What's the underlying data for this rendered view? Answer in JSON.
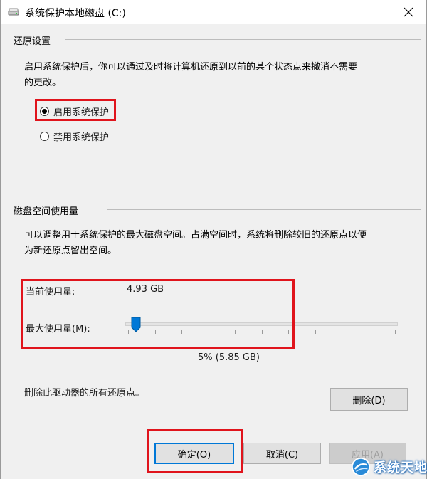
{
  "window": {
    "title": "系统保护本地磁盘 (C:)",
    "close_glyph": "✕"
  },
  "restore_settings": {
    "group_label": "还原设置",
    "description_line1": "启用系统保护后，你可以通过及时将计算机还原到以前的某个状态点来撤消不需要",
    "description_line2": "的更改。",
    "options": [
      {
        "label": "启用系统保护",
        "selected": true
      },
      {
        "label": "禁用系统保护",
        "selected": false
      }
    ]
  },
  "disk_usage": {
    "group_label": "磁盘空间使用量",
    "description_line1": "可以调整用于系统保护的最大磁盘空间。占满空间时，系统将删除较旧的还原点以便",
    "description_line2": "为新还原点留出空间。",
    "current_usage_label": "当前使用量:",
    "current_usage_value": "4.93 GB",
    "max_usage_label": "最大使用量(M):",
    "max_usage_value": "5% (5.85 GB)",
    "max_usage_percent": 5
  },
  "delete_section": {
    "description": "删除此驱动器的所有还原点。",
    "delete_button": "删除(D)"
  },
  "footer": {
    "ok_button": "确定(O)",
    "cancel_button": "取消(C)",
    "apply_button": "应用(A)"
  },
  "watermark": {
    "text": "系统天地"
  },
  "colors": {
    "highlight_box": "#e0141c",
    "slider_thumb": "#0078d7",
    "primary_border": "#0078d7"
  }
}
